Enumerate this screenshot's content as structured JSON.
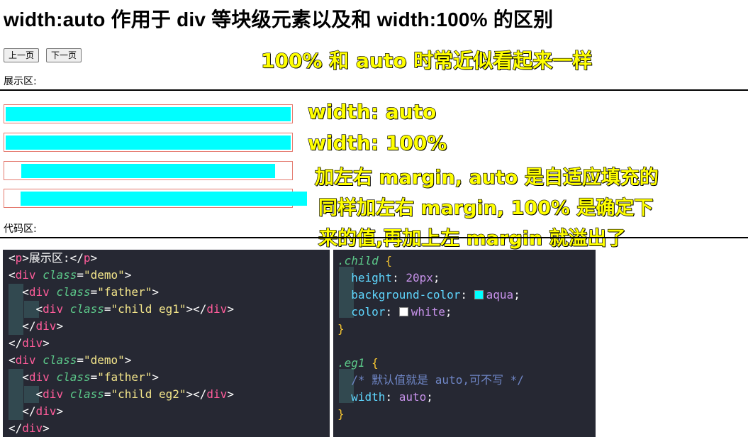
{
  "page": {
    "title": "width:auto 作用于 div 等块级元素以及和 width:100% 的区别",
    "buttons": {
      "prev": "上一页",
      "next": "下一页"
    },
    "display_label": "展示区:",
    "code_label": "代码区:"
  },
  "annotations": {
    "headline": "100% 和 auto 时常近似看起来一样",
    "auto": "width: auto",
    "full": "width: 100%",
    "margin_auto": "加左右 margin, auto 是自适应填充的",
    "margin_full_1": "同样加左右 margin, 100% 是确定下",
    "margin_full_2": "来的值,再加上左 margin 就溢出了"
  },
  "colors": {
    "child_bg": "#00ffff",
    "father_border": "#e47a6f",
    "editor_bg": "#262833",
    "annotation_fill": "#ffff00",
    "annotation_stroke": "#000000"
  },
  "html_code": {
    "l1": {
      "lt": "<",
      "tag": "p",
      "gt": ">",
      "text": "展示区:",
      "lt2": "</",
      "tag2": "p",
      "gt2": ">"
    },
    "l2": {
      "lt": "<",
      "tag": "div",
      "attr": "class",
      "eq": "=",
      "val": "\"demo\"",
      "gt": ">"
    },
    "l3": {
      "lt": "<",
      "tag": "div",
      "attr": "class",
      "eq": "=",
      "val": "\"father\"",
      "gt": ">"
    },
    "l4": {
      "lt": "<",
      "tag": "div",
      "attr": "class",
      "eq": "=",
      "val": "\"child eg1\"",
      "gt": ">",
      "lt2": "</",
      "tag2": "div",
      "gt2": ">"
    },
    "l5": {
      "lt": "</",
      "tag": "div",
      "gt": ">"
    },
    "l6": {
      "lt": "</",
      "tag": "div",
      "gt": ">"
    },
    "l7": {
      "lt": "<",
      "tag": "div",
      "attr": "class",
      "eq": "=",
      "val": "\"demo\"",
      "gt": ">"
    },
    "l8": {
      "lt": "<",
      "tag": "div",
      "attr": "class",
      "eq": "=",
      "val": "\"father\"",
      "gt": ">"
    },
    "l9": {
      "lt": "<",
      "tag": "div",
      "attr": "class",
      "eq": "=",
      "val": "\"child eg2\"",
      "gt": ">",
      "lt2": "</",
      "tag2": "div",
      "gt2": ">"
    },
    "l10": {
      "lt": "</",
      "tag": "div",
      "gt": ">"
    },
    "l11": {
      "lt": "</",
      "tag": "div",
      "gt": ">"
    }
  },
  "css_code": {
    "l1": {
      "sel": ".child",
      "brace": " {"
    },
    "l2": {
      "prop": "height",
      "colon": ": ",
      "val": "20px",
      "semi": ";"
    },
    "l3": {
      "prop": "background-color",
      "colon": ": ",
      "val": "aqua",
      "semi": ";",
      "swatch": "#00ffff"
    },
    "l4": {
      "prop": "color",
      "colon": ": ",
      "val": "white",
      "semi": ";",
      "swatch": "#ffffff"
    },
    "l5": {
      "brace": "}"
    },
    "l6": {
      "sel": ".eg1",
      "brace": " {"
    },
    "l7": {
      "comment": "/* 默认值就是 auto,可不写 */"
    },
    "l8": {
      "prop": "width",
      "colon": ": ",
      "val": "auto",
      "semi": ";"
    },
    "l9": {
      "brace": "}"
    }
  }
}
